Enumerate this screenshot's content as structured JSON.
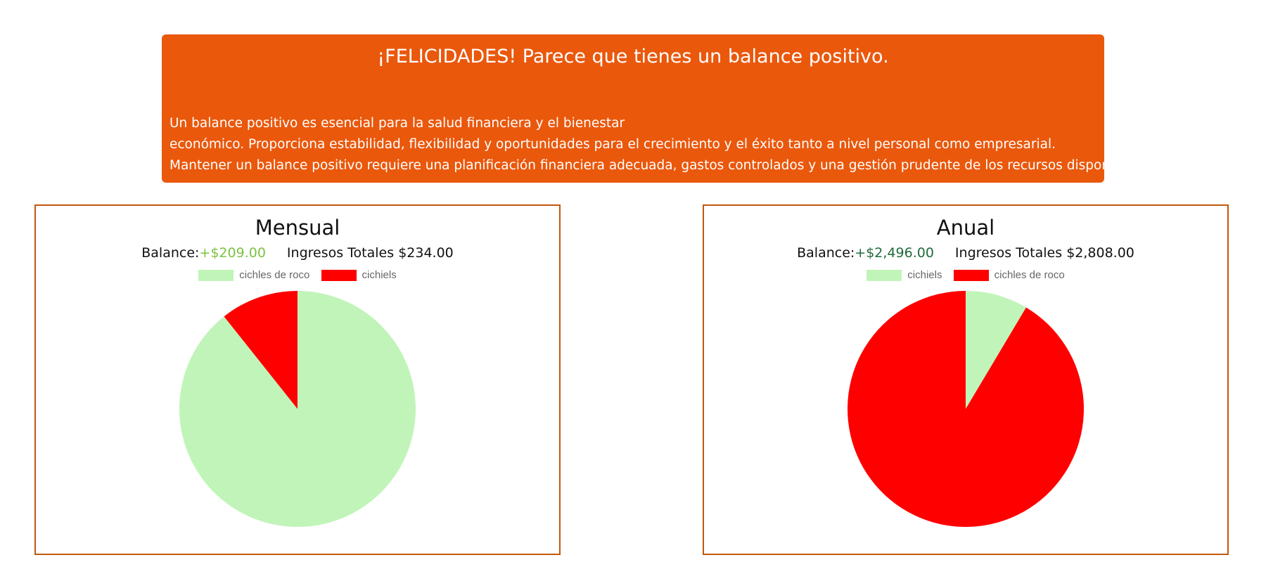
{
  "banner": {
    "title": "¡FELICIDADES! Parece que tienes un balance positivo.",
    "lines": [
      "Un balance positivo es esencial para la salud financiera y el bienestar",
      "económico. Proporciona estabilidad, flexibilidad y oportunidades para el crecimiento y el éxito tanto a nivel personal como empresarial.",
      "Mantener un balance positivo requiere una planificación financiera adecuada, gastos controlados y una gestión prudente de los recursos disponibles."
    ]
  },
  "colors": {
    "banner_bg": "#ea580c",
    "card_border": "#c2570c",
    "light_green": "#c1f4b9",
    "red": "#ff0000"
  },
  "chart_data": [
    {
      "type": "pie",
      "title": "Mensual",
      "balance_label": "Balance:",
      "balance_value": "+$209.00",
      "income_label": "Ingresos Totales",
      "income_value": "$234.00",
      "legend_position": "top",
      "categories": [
        "cichles de roco",
        "cichiels"
      ],
      "values": [
        209,
        25
      ],
      "colors": [
        "#c1f4b9",
        "#ff0000"
      ]
    },
    {
      "type": "pie",
      "title": "Anual",
      "balance_label": "Balance:",
      "balance_value": "+$2,496.00",
      "income_label": "Ingresos Totales",
      "income_value": "$2,808.00",
      "legend_position": "top",
      "categories": [
        "cichiels",
        "cichles de roco"
      ],
      "values": [
        240,
        2568
      ],
      "colors": [
        "#c1f4b9",
        "#ff0000"
      ]
    }
  ]
}
